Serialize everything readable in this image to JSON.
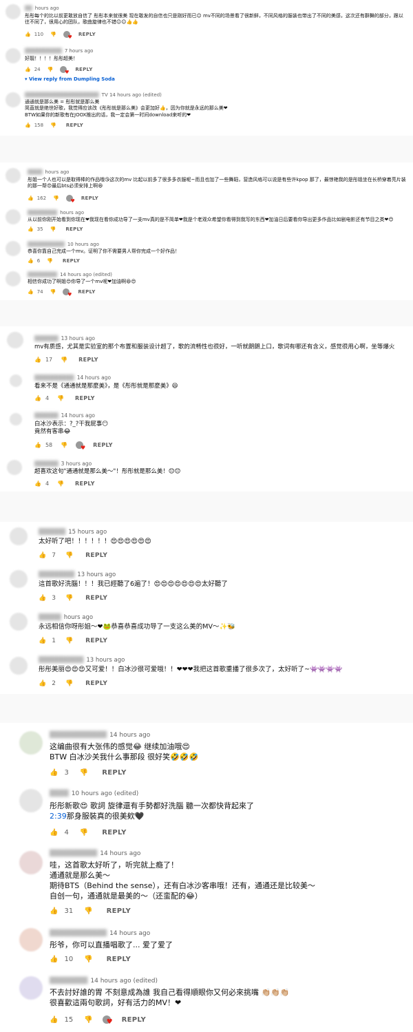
{
  "labels": {
    "reply": "REPLY"
  },
  "sections": [
    {
      "comments": [
        {
          "time": "hours ago",
          "text": "彤彤每个的比以前更敢放自信了 彤彤本来就很美 现在敢发的自信也只是刚好而已☺ mv不同的场景看了很新鲜，不同风格的服装也带出了不同的美感，这次还有群舞的部分，跟以往不同了，很用心的团队，歌曲旋律也不错☺☺👍👍",
          "likes": "110",
          "liked": true
        },
        {
          "time": "7 hours ago",
          "text": "好靓！！！！彤彤超美！",
          "likes": "24",
          "liked": true,
          "view_reply": "View reply from Dumpling Soda"
        },
        {
          "time": "TV 14 hours ago (edited)",
          "text": "通通就是那么美 = 彤彤就是那么美\n简直就是绝世好歌，我觉得应该改《彤彤就是那么美》会更加好👍，因为你就是永远的那么美❤\nBTW如果你的新歌有在JOOX推出的话，我一定会第一时间download来听的❤",
          "likes": "158",
          "liked": false
        }
      ]
    },
    {
      "comments": [
        {
          "time": "hours ago",
          "text": "彤姐一个人也可以是取得棒的作品哦😘这次的mv 比起以前多了很多多衣服呢~而且也加了一些舞蹈，营造风格可以说是有些许kpop 那了，最惊艳我的是彤姐坐在长桥穿着亮片装的那一帮😍最后bts必须安排上啊😆",
          "likes": "162",
          "liked": true
        },
        {
          "time": "hours ago",
          "text": "从以前你刚开始看到你现在❤我现在看你成功导了一支mv真的是不简单❤我是个老观众希望你看得到我写的东西❤加油日后要看你导出更多作品比如剧电影还有节目之类❤😊",
          "likes": "35",
          "liked": false
        },
        {
          "time": "10 hours ago",
          "text": "恭喜你靠自己完成一个mv。证明了你不需要男人帮你完成一个好作品！",
          "likes": "6",
          "liked": false
        },
        {
          "time": "14 hours ago (edited)",
          "text": "相信你成功了啊姐😍你导了一个mv呢❤加油啊😆😍",
          "likes": "74",
          "liked": true
        }
      ]
    },
    {
      "comments": [
        {
          "time": "13 hours ago",
          "text": "mv有质感，尤其是实验室的那个布置和服装设计超了，歌的流畅性也很好，一听就朗朗上口，歌词有哪还有含义，感觉很用心啊，坐等爆火",
          "likes": "17",
          "liked": false
        },
        {
          "time": "14 hours ago",
          "text": "看来不是《通通就是那麼美》，是《彤彤就是那麼美》😆",
          "likes": "4",
          "liked": false
        },
        {
          "time": "14 hours ago",
          "text": "白冰沙表示：?_?干我屁事😶\n竟然有客串😂",
          "likes": "58",
          "liked": true
        },
        {
          "time": "3 hours ago",
          "text": "超喜欢这句\"通通就是那么美～\"！彤彤就是那么美！😊😊",
          "likes": "4",
          "liked": false
        }
      ]
    },
    {
      "comments": [
        {
          "time": "15 hours ago",
          "text": "太好听了吧！！！！！！😍😍😍😍😍😍",
          "likes": "7",
          "liked": false
        },
        {
          "time": "13 hours ago",
          "text": "這首歌好洗腦！！！我已經聽了6遍了！😍😍😍😍😍😍😍太好聽了",
          "likes": "3",
          "liked": false
        },
        {
          "time": "hours ago",
          "text": "永远相信你呀彤姐～❤🐸恭喜恭喜成功导了一支这么美的MV～✨🐝",
          "likes": "1",
          "liked": false
        },
        {
          "time": "13 hours ago",
          "text": "彤彤美丽😍😍😍又可爱！！白冰沙很可爱哦！！❤❤❤我把这首歌重播了很多次了，太好听了~👾👾👾👾",
          "likes": "2",
          "liked": false
        }
      ]
    },
    {
      "comments": [
        {
          "time": "14 hours ago",
          "text": "这编曲很有大张伟的感觉😂 继续加油哦😍\nBTW 白冰沙关我什么事那段 很好笑🤣🤣🤣",
          "likes": "3",
          "liked": false
        },
        {
          "time": "10 hours ago (edited)",
          "text_before": "彤彤新歌😍 歌詞 旋律還有手勢都好洗腦 聽一次都快背起來了\n",
          "link": "2:39",
          "text_after": "那身服裝真的很美欸🖤",
          "likes": "4",
          "liked": false
        },
        {
          "time": "14 hours ago",
          "text": "哇，这首歌太好听了，听完就上瘾了！\n通通就是那么美～\n期待BTS（Behind the sense），还有白冰沙客串哦！还有，通通还是比较美～\n自创一句，通通就是最美的～（还蛮配的😂）",
          "likes": "31",
          "liked": false
        },
        {
          "time": "14 hours ago",
          "text": "彤爷，你可以直播唱歌了... 爱了爱了",
          "likes": "10",
          "liked": false
        },
        {
          "time": "14 hours ago (edited)",
          "text": "不去討好誰的胃 不刻意成為誰 我自己看得順眼你又何必來挑嘴 👏🏼👏🏼👏🏼\n很喜歡這兩句歌詞，好有活力的MV！❤",
          "likes": "15",
          "liked": true
        }
      ]
    }
  ]
}
